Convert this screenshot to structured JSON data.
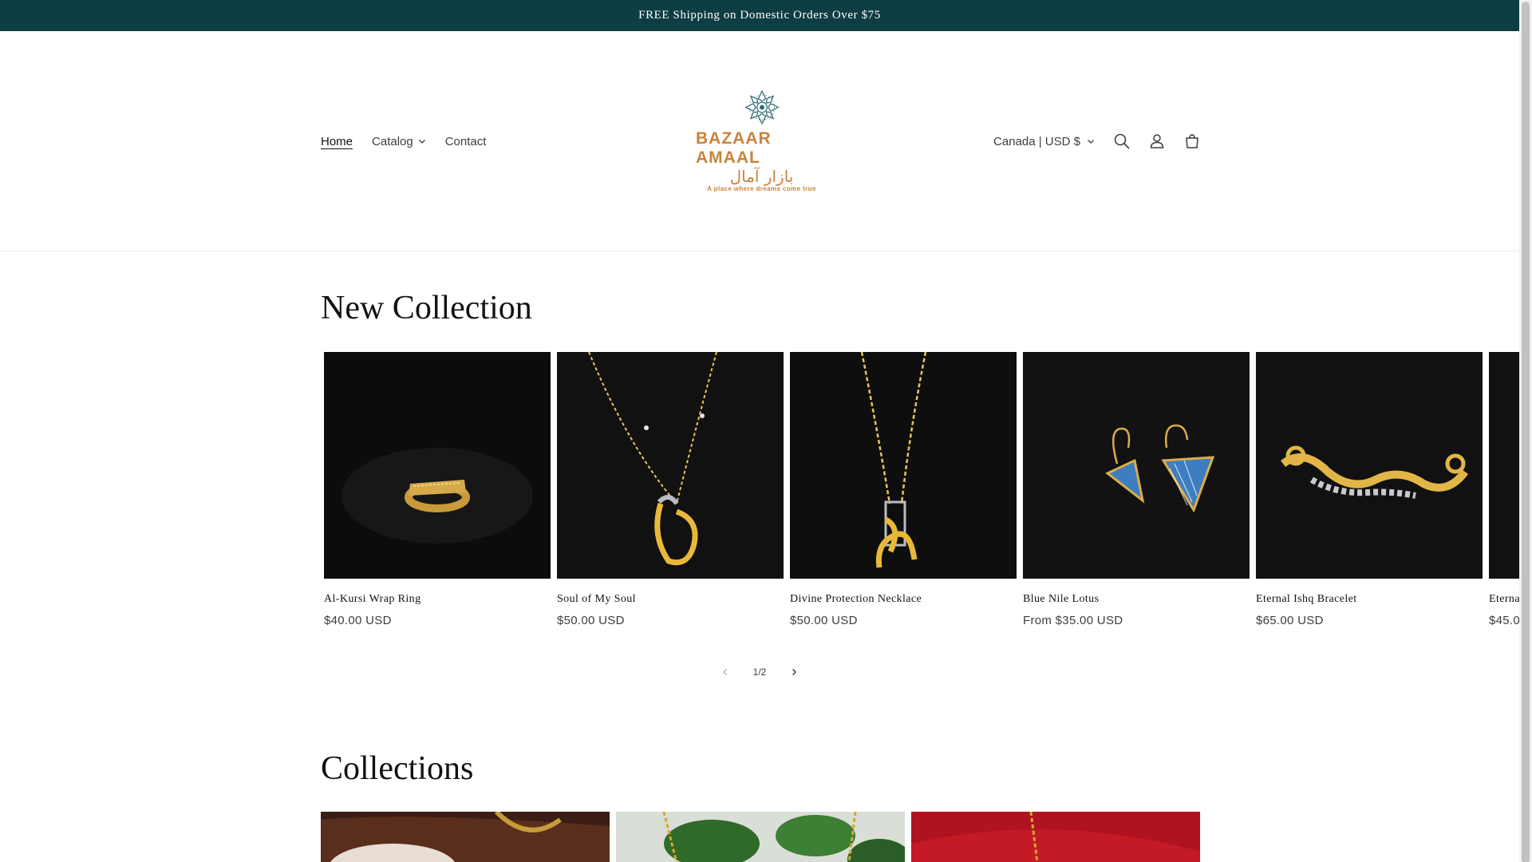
{
  "announcement": "FREE Shipping on Domestic Orders Over $75",
  "nav": {
    "home": "Home",
    "catalog": "Catalog",
    "contact": "Contact"
  },
  "logo": {
    "brand": "BAZAAR AMAAL",
    "arabic": "بازار آمال",
    "tagline": "A place where dreams come true"
  },
  "header_right": {
    "country": "Canada | USD $"
  },
  "icons": {
    "search": "search-icon",
    "account": "account-icon",
    "cart": "cart-icon"
  },
  "new_collection": {
    "title": "New Collection",
    "products": [
      {
        "name": "Al-Kursi Wrap Ring",
        "price": "$40.00 USD"
      },
      {
        "name": "Soul of My Soul",
        "price": "$50.00 USD"
      },
      {
        "name": "Divine Protection Necklace",
        "price": "$50.00 USD"
      },
      {
        "name": "Blue Nile Lotus",
        "price": "From $35.00 USD"
      },
      {
        "name": "Eternal Ishq Bracelet",
        "price": "$65.00 USD"
      },
      {
        "name": "Eternal",
        "price": "$45.0"
      }
    ],
    "pagination": "1/2"
  },
  "collections": {
    "title": "Collections"
  },
  "colors": {
    "announcement_bg": "#0f3d44",
    "logo_gold": "#c8833c",
    "logo_teal": "#2f6b73"
  }
}
